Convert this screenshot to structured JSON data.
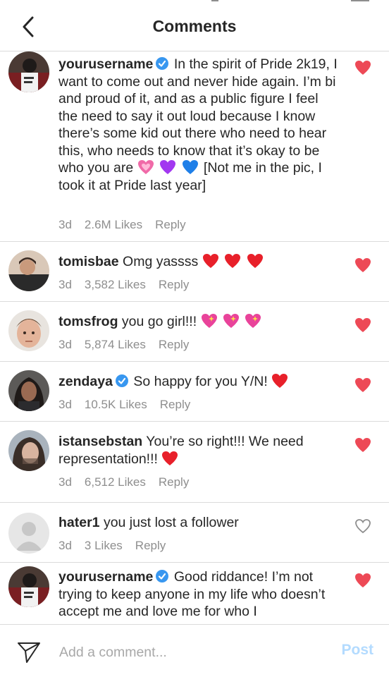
{
  "header": {
    "title": "Comments"
  },
  "comments": [
    {
      "username": "yourusername",
      "verified": true,
      "text_1": "In the spirit of Pride 2k19, I want to come out and never hide again. I’m bi and proud of it, and as a public figure I feel the need to say it out loud because I know there’s some kid out there who need to hear this, who needs to know that it’s okay to be who you are",
      "text_2": "[Not me in the pic, I took it at Pride last year]",
      "emojis": [
        "growing-heart",
        "purple-heart",
        "blue-heart"
      ],
      "time": "3d",
      "likes": "2.6M Likes",
      "reply": "Reply",
      "liked": true
    },
    {
      "username": "tomisbae",
      "verified": false,
      "text": "Omg yassss",
      "emojis": [
        "red-heart",
        "red-heart",
        "red-heart"
      ],
      "time": "3d",
      "likes": "3,582 Likes",
      "reply": "Reply",
      "liked": true
    },
    {
      "username": "tomsfrog",
      "verified": false,
      "text": "you go girl!!!",
      "emojis": [
        "sparkling-heart",
        "sparkling-heart",
        "sparkling-heart"
      ],
      "time": "3d",
      "likes": "5,874 Likes",
      "reply": "Reply",
      "liked": true
    },
    {
      "username": "zendaya",
      "verified": true,
      "text": "So happy for you Y/N!",
      "emojis": [
        "red-heart"
      ],
      "time": "3d",
      "likes": "10.5K Likes",
      "reply": "Reply",
      "liked": true
    },
    {
      "username": "istansebstan",
      "verified": false,
      "text": "You’re so right!!! We need representation!!!",
      "emojis": [
        "red-heart"
      ],
      "time": "3d",
      "likes": "6,512 Likes",
      "reply": "Reply",
      "liked": true
    },
    {
      "username": "hater1",
      "verified": false,
      "text": "you just lost a follower",
      "emojis": [],
      "time": "3d",
      "likes": "3 Likes",
      "reply": "Reply",
      "liked": false
    },
    {
      "username": "yourusername",
      "verified": true,
      "text": "Good riddance! I’m not trying to keep anyone in my life who doesn’t accept me and love me for who I",
      "emojis": [],
      "liked": true
    }
  ],
  "footer": {
    "input_placeholder": "Add a comment...",
    "post_label": "Post"
  },
  "colors": {
    "heart_liked": "#ed4956",
    "verified_badge": "#3897f0",
    "meta_text": "#8e8e8e",
    "post_disabled": "#b3dbff",
    "divider": "#dbdbdb"
  },
  "icons": {
    "back": "chevron-left-icon",
    "verified": "verified-badge-icon",
    "like": "heart-icon",
    "send": "paper-plane-icon"
  }
}
